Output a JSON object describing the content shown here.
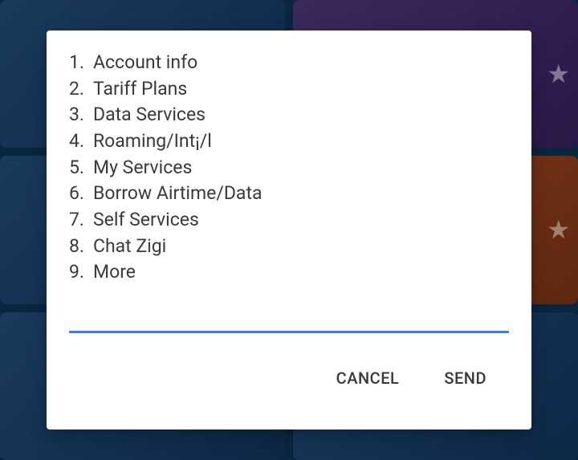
{
  "menu": {
    "items": [
      {
        "number": "1.",
        "label": "Account info"
      },
      {
        "number": "2.",
        "label": "Tariff Plans"
      },
      {
        "number": "3.",
        "label": "Data Services"
      },
      {
        "number": "4.",
        "label": "Roaming/Int¡/l"
      },
      {
        "number": "5.",
        "label": "My Services"
      },
      {
        "number": "6.",
        "label": "Borrow Airtime/Data"
      },
      {
        "number": "7.",
        "label": "Self Services"
      },
      {
        "number": "8.",
        "label": "Chat Zigi"
      },
      {
        "number": "9.",
        "label": "More"
      }
    ]
  },
  "input": {
    "value": ""
  },
  "actions": {
    "cancel_label": "CANCEL",
    "send_label": "SEND"
  }
}
